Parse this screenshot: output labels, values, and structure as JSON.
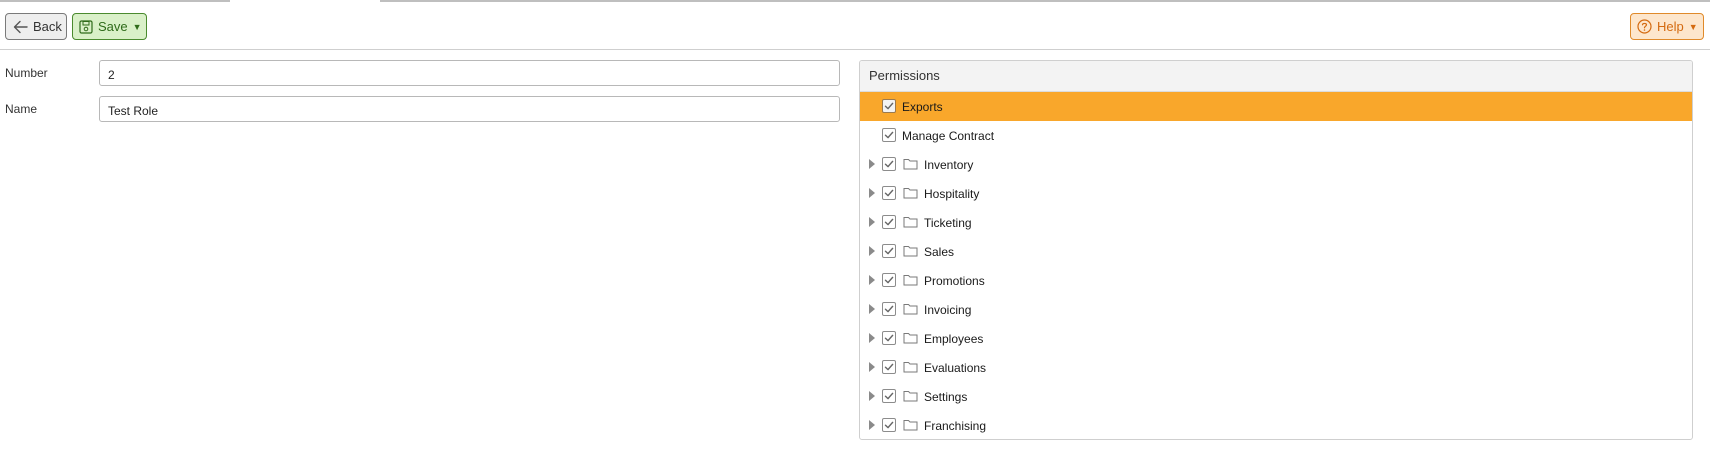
{
  "toolbar": {
    "back_label": "Back",
    "save_label": "Save",
    "help_label": "Help"
  },
  "form": {
    "number_label": "Number",
    "number_value": "2",
    "name_label": "Name",
    "name_value": "Test Role"
  },
  "permissions": {
    "title": "Permissions",
    "items": [
      {
        "label": "Exports",
        "checked": true,
        "selected": true,
        "folder": false,
        "expandable": false
      },
      {
        "label": "Manage Contract",
        "checked": true,
        "selected": false,
        "folder": false,
        "expandable": false
      },
      {
        "label": "Inventory",
        "checked": true,
        "selected": false,
        "folder": true,
        "expandable": true
      },
      {
        "label": "Hospitality",
        "checked": true,
        "selected": false,
        "folder": true,
        "expandable": true
      },
      {
        "label": "Ticketing",
        "checked": true,
        "selected": false,
        "folder": true,
        "expandable": true
      },
      {
        "label": "Sales",
        "checked": true,
        "selected": false,
        "folder": true,
        "expandable": true
      },
      {
        "label": "Promotions",
        "checked": true,
        "selected": false,
        "folder": true,
        "expandable": true
      },
      {
        "label": "Invoicing",
        "checked": true,
        "selected": false,
        "folder": true,
        "expandable": true
      },
      {
        "label": "Employees",
        "checked": true,
        "selected": false,
        "folder": true,
        "expandable": true
      },
      {
        "label": "Evaluations",
        "checked": true,
        "selected": false,
        "folder": true,
        "expandable": true
      },
      {
        "label": "Settings",
        "checked": true,
        "selected": false,
        "folder": true,
        "expandable": true
      },
      {
        "label": "Franchising",
        "checked": true,
        "selected": false,
        "folder": true,
        "expandable": true
      }
    ]
  },
  "colors": {
    "selected_row": "#f9a72b",
    "save_bg": "#d9f0c8",
    "help_bg": "#fde6cc",
    "help_text": "#d46a10"
  },
  "icons": {
    "back": "arrow-left-icon",
    "save": "floppy-disk-icon",
    "help": "question-circle-icon",
    "folder": "folder-icon",
    "checkbox": "checkbox-checked-icon"
  }
}
